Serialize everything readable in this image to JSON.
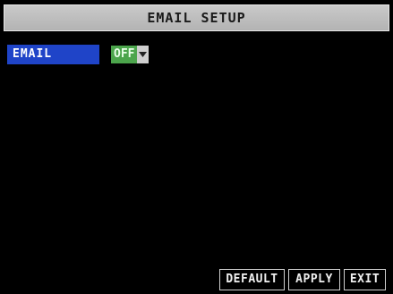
{
  "window": {
    "title": "EMAIL SETUP"
  },
  "settings": {
    "email": {
      "label": "EMAIL",
      "value": "OFF"
    }
  },
  "buttons": {
    "default": "DEFAULT",
    "apply": "APPLY",
    "exit": "EXIT"
  },
  "icons": {
    "dropdown": "chevron-down-icon"
  },
  "colors": {
    "title_bar": "#c0c0c0",
    "label_highlight": "#1f44c8",
    "select_value_bg": "#4ca54c",
    "background": "#000000"
  }
}
